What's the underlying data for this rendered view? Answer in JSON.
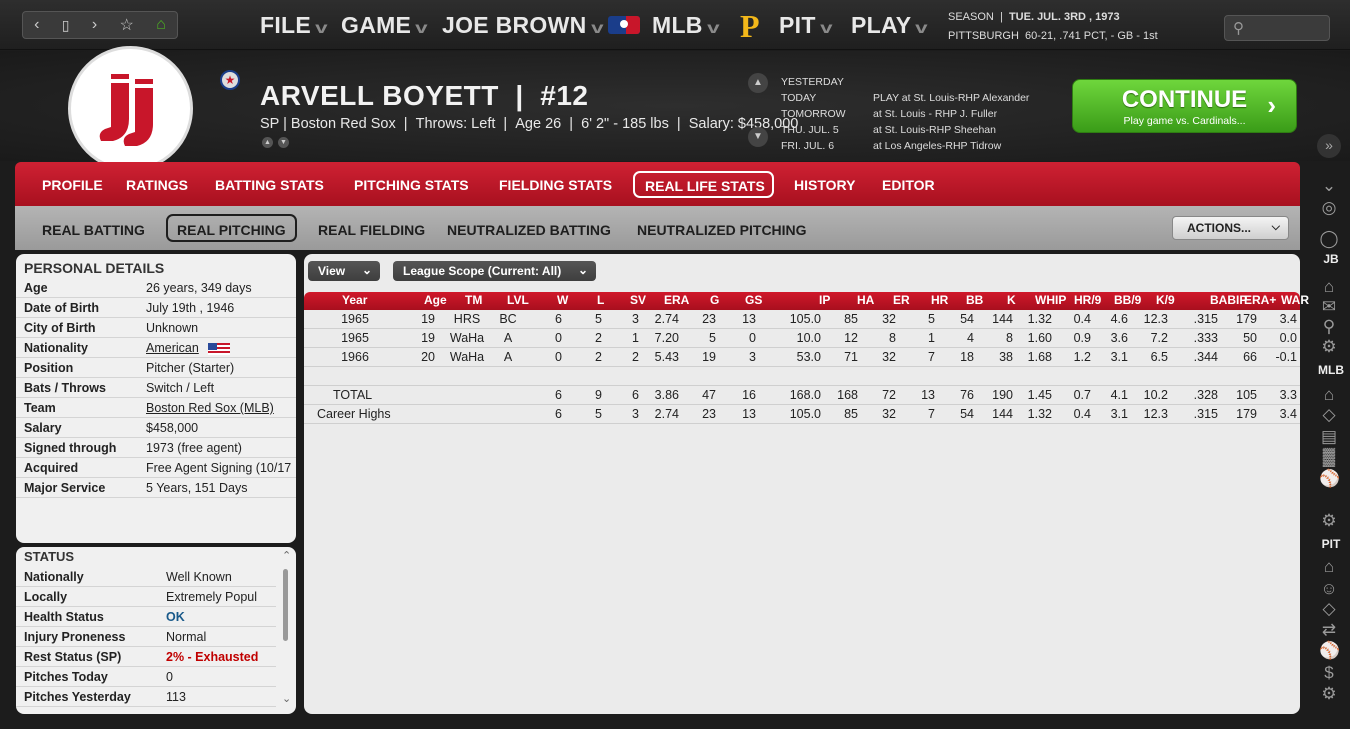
{
  "topbar": {
    "menus": [
      "FILE",
      "GAME",
      "JOE BROWN",
      "MLB",
      "PIT",
      "PLAY"
    ],
    "season_label": "SEASON",
    "date": "TUE. JUL. 3RD , 1973",
    "team_line_label": "PITTSBURGH",
    "team_line_value": "60-21, .741 PCT, - GB - 1st"
  },
  "player": {
    "name": "ARVELL BOYETT",
    "number": "#12",
    "position_team": "SP | Boston Red Sox",
    "throws": "Throws: Left",
    "age": "Age 26",
    "size": "6' 2\" - 185 lbs",
    "salary": "Salary: $458,000"
  },
  "schedule": {
    "days": [
      "YESTERDAY",
      "TODAY",
      "TOMORROW",
      "THU. JUL. 5",
      "FRI. JUL. 6"
    ],
    "games": [
      "PLAY at St. Louis-RHP Alexander",
      "at St. Louis - RHP J. Fuller",
      "at St. Louis-RHP Sheehan",
      "at Los Angeles-RHP Tidrow"
    ]
  },
  "continue": {
    "label": "CONTINUE",
    "sub": "Play game vs. Cardinals..."
  },
  "tabs": [
    "PROFILE",
    "RATINGS",
    "BATTING STATS",
    "PITCHING STATS",
    "FIELDING STATS",
    "REAL LIFE STATS",
    "HISTORY",
    "EDITOR"
  ],
  "subtabs": [
    "REAL BATTING",
    "REAL PITCHING",
    "REAL FIELDING",
    "NEUTRALIZED BATTING",
    "NEUTRALIZED PITCHING"
  ],
  "actions_label": "ACTIONS...",
  "personal": {
    "title": "PERSONAL DETAILS",
    "rows": [
      {
        "k": "Age",
        "v": "26 years, 349 days"
      },
      {
        "k": "Date of Birth",
        "v": "July 19th , 1946"
      },
      {
        "k": "City of Birth",
        "v": "Unknown"
      },
      {
        "k": "Nationality",
        "v": "American"
      },
      {
        "k": "Position",
        "v": "Pitcher (Starter)"
      },
      {
        "k": "Bats / Throws",
        "v": "Switch / Left"
      },
      {
        "k": "Team",
        "v": "Boston Red Sox (MLB)"
      },
      {
        "k": "Salary",
        "v": "$458,000"
      },
      {
        "k": "Signed through",
        "v": "1973 (free agent)"
      },
      {
        "k": "Acquired",
        "v": "Free Agent Signing (10/17"
      },
      {
        "k": "Major Service",
        "v": "5 Years, 151 Days"
      }
    ]
  },
  "status": {
    "title": "STATUS",
    "rows": [
      {
        "k": "Nationally",
        "v": "Well Known"
      },
      {
        "k": "Locally",
        "v": "Extremely Popul"
      },
      {
        "k": "Health Status",
        "v": "OK"
      },
      {
        "k": "Injury Proneness",
        "v": "Normal"
      },
      {
        "k": "Rest Status (SP)",
        "v": "2% - Exhausted"
      },
      {
        "k": "Pitches Today",
        "v": "0"
      },
      {
        "k": "Pitches Yesterday",
        "v": "113"
      }
    ],
    "colors": {
      "ok": "#1a5a8a",
      "exhausted": "#c00000"
    }
  },
  "filters": {
    "view": "View",
    "scope": "League Scope (Current: All)"
  },
  "table": {
    "headers": [
      "Year",
      "Age",
      "TM",
      "LVL",
      "W",
      "L",
      "SV",
      "ERA",
      "G",
      "GS",
      "IP",
      "HA",
      "ER",
      "HR",
      "BB",
      "K",
      "WHIP",
      "HR/9",
      "BB/9",
      "K/9",
      "BABIP",
      "ERA+",
      "WAR"
    ],
    "rows": [
      [
        "1965",
        "19",
        "HRS",
        "BC",
        "6",
        "5",
        "3",
        "2.74",
        "23",
        "13",
        "105.0",
        "85",
        "32",
        "5",
        "54",
        "144",
        "1.32",
        "0.4",
        "4.6",
        "12.3",
        ".315",
        "179",
        "3.4"
      ],
      [
        "1965",
        "19",
        "WaHa",
        "A",
        "0",
        "2",
        "1",
        "7.20",
        "5",
        "0",
        "10.0",
        "12",
        "8",
        "1",
        "4",
        "8",
        "1.60",
        "0.9",
        "3.6",
        "7.2",
        ".333",
        "50",
        "0.0"
      ],
      [
        "1966",
        "20",
        "WaHa",
        "A",
        "0",
        "2",
        "2",
        "5.43",
        "19",
        "3",
        "53.0",
        "71",
        "32",
        "7",
        "18",
        "38",
        "1.68",
        "1.2",
        "3.1",
        "6.5",
        ".344",
        "66",
        "-0.1"
      ]
    ],
    "total": [
      "TOTAL",
      "",
      "",
      "",
      "6",
      "9",
      "6",
      "3.86",
      "47",
      "16",
      "168.0",
      "168",
      "72",
      "13",
      "76",
      "190",
      "1.45",
      "0.7",
      "4.1",
      "10.2",
      ".328",
      "105",
      "3.3"
    ],
    "career": [
      "Career Highs",
      "",
      "",
      "",
      "6",
      "5",
      "3",
      "2.74",
      "23",
      "13",
      "105.0",
      "85",
      "32",
      "7",
      "54",
      "144",
      "1.32",
      "0.4",
      "3.1",
      "12.3",
      ".315",
      "179",
      "3.4"
    ]
  },
  "sidebar_labels": [
    "JB",
    "MLB",
    "PIT"
  ],
  "colors": {
    "accent_red": "#c8162a",
    "continue_green": "#4caf22"
  }
}
